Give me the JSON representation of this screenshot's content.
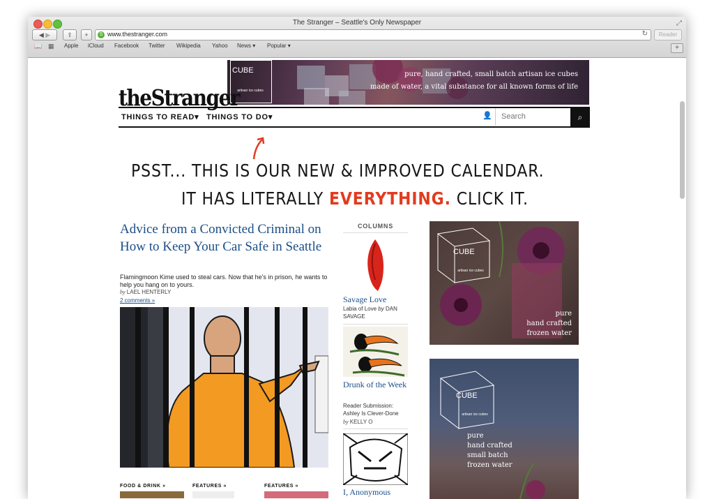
{
  "browser": {
    "window_title": "The Stranger – Seattle's Only Newspaper",
    "url": "www.thestranger.com",
    "reader_label": "Reader",
    "bookmarks": [
      "Apple",
      "iCloud",
      "Facebook",
      "Twitter",
      "Wikipedia",
      "Yahoo",
      "News ▾",
      "Popular ▾"
    ]
  },
  "site": {
    "logo": "theStranger",
    "nav": {
      "read": "THINGS TO READ▾",
      "do": "THINGS TO DO▾",
      "search_placeholder": "Search"
    }
  },
  "top_ad": {
    "brand": "CUBE",
    "brand_sub": "artisan ice cubes",
    "line1": "pure, hand crafted, small batch artisan ice cubes",
    "line2": "made of water, a vital substance for all known forms of life"
  },
  "promo": {
    "line1_part1": "PSST... THIS",
    "line1_part2": "IS OUR NEW & IMPROVED CALENDAR.",
    "line2_part1": "IT HAS LITERALLY",
    "line2_red": "EVERYTHING.",
    "line2_part2": "CLICK IT."
  },
  "lead_story": {
    "headline": "Advice from a Convicted Criminal on How to Keep Your Car Safe in Seattle",
    "dek": "Flamingmoon Kime used to steal cars. Now that he's in prison, he wants to help you hang on to yours.",
    "by": "by",
    "author": "LAEL HENTERLY",
    "comments": "2 comments »"
  },
  "sections": [
    "FOOD & DRINK »",
    "FEATURES »",
    "FEATURES »"
  ],
  "columns": {
    "title": "COLUMNS",
    "items": [
      {
        "title": "Savage Love",
        "dek": "Labia of Love",
        "by": "by",
        "author": "DAN SAVAGE"
      },
      {
        "title": "Drunk of the Week",
        "dek": "Reader Submission: Ashley Is Clever-Done",
        "by": "by",
        "author": "KELLY O"
      },
      {
        "title": "I, Anonymous"
      }
    ]
  },
  "side_ad1": {
    "brand": "CUBE",
    "brand_sub": "artisan ice cubes",
    "l1": "pure",
    "l2": "hand crafted",
    "l3": "frozen water"
  },
  "side_ad2": {
    "brand": "CUBE",
    "brand_sub": "artisan ice cubes",
    "l1": "pure",
    "l2": "hand crafted",
    "l3": "small batch",
    "l4": "frozen water"
  }
}
